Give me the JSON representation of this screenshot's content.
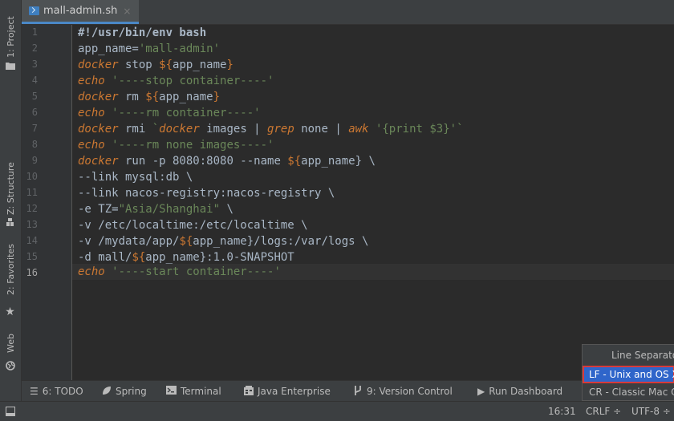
{
  "tab": {
    "filename": "mall-admin.sh",
    "close": "×"
  },
  "left_tools": [
    {
      "label": "1: Project",
      "icon": "folder-icon"
    },
    {
      "label": "Z: Structure",
      "icon": "structure-icon"
    },
    {
      "label": "2: Favorites",
      "icon": "star-icon"
    },
    {
      "label": "Web",
      "icon": "web-icon"
    }
  ],
  "line_numbers": [
    "1",
    "2",
    "3",
    "4",
    "5",
    "6",
    "7",
    "8",
    "9",
    "10",
    "11",
    "12",
    "13",
    "14",
    "15",
    "16"
  ],
  "code": {
    "l1": "#!/usr/bin/env bash",
    "l2a": "app_name=",
    "l2b": "'mall-admin'",
    "l3a": "docker",
    "l3b": " stop ",
    "l3c": "${",
    "l3d": "app_name",
    "l3e": "}",
    "l4a": "echo",
    "l4b": " ",
    "l4c": "'----stop container----'",
    "l5a": "docker",
    "l5b": " rm ",
    "l5c": "${",
    "l5d": "app_name",
    "l5e": "}",
    "l6a": "echo",
    "l6b": " ",
    "l6c": "'----rm container----'",
    "l7a": "docker",
    "l7b": " rmi ",
    "l7c": "`",
    "l7d": "docker",
    "l7e": " images | ",
    "l7f": "grep",
    "l7g": " none | ",
    "l7h": "awk",
    "l7i": " ",
    "l7j": "'{print $3}'",
    "l7k": "`",
    "l8a": "echo",
    "l8b": " ",
    "l8c": "'----rm none images----'",
    "l9a": "docker",
    "l9b": " run -p 8080:8080 --name ",
    "l9c": "${",
    "l9d": "app_name",
    "l9e": "} \\",
    "l10": "--link mysql:db \\",
    "l11": "--link nacos-registry:nacos-registry \\",
    "l12a": "-e TZ=",
    "l12b": "\"Asia/Shanghai\"",
    "l12c": " \\",
    "l13": "-v /etc/localtime:/etc/localtime \\",
    "l14a": "-v /mydata/app/",
    "l14b": "${",
    "l14c": "app_name",
    "l14d": "}/logs:/var/logs \\",
    "l15a": "-d mall/",
    "l15b": "${",
    "l15c": "app_name",
    "l15d": "}:1.0-SNAPSHOT",
    "l16a": "echo",
    "l16b": " ",
    "l16c": "'----start container----'"
  },
  "bottom_tools": {
    "todo": "6: TODO",
    "spring": "Spring",
    "terminal": "Terminal",
    "java_enterprise": "Java Enterprise",
    "version_control": "9: Version Control",
    "run_dashboard": "Run Dashboard"
  },
  "status": {
    "position": "16:31",
    "line_sep": "CRLF ÷",
    "encoding": "UTF-8 ÷"
  },
  "popup": {
    "title": "Line Separators",
    "items": [
      "LF - Unix and OS X (\\n)",
      "CR - Classic Mac OS (\\r)"
    ]
  },
  "colors": {
    "keyword": "#cc7832",
    "string": "#6a8759",
    "text": "#a9b7c6",
    "selection": "#2f65ca",
    "highlight_border": "#d83a3a"
  }
}
